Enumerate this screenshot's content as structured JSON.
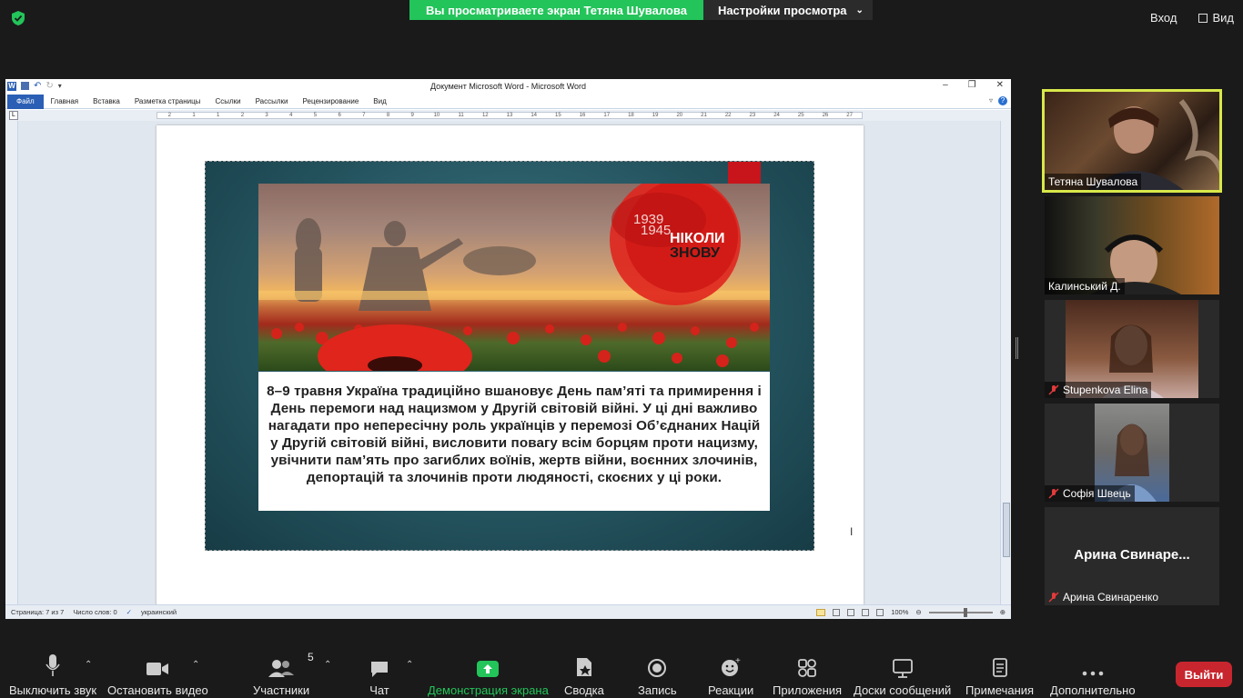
{
  "top": {
    "share_notice": "Вы просматриваете экран Тетяна Шувалова",
    "view_settings": "Настройки просмотра",
    "sign_in": "Вход",
    "view": "Вид"
  },
  "word": {
    "title": "Документ Microsoft Word - Microsoft Word",
    "tabs": [
      "Файл",
      "Главная",
      "Вставка",
      "Разметка страницы",
      "Ссылки",
      "Рассылки",
      "Рецензирование",
      "Вид"
    ],
    "ruler_ticks": [
      "2",
      "1",
      "1",
      "2",
      "3",
      "4",
      "5",
      "6",
      "7",
      "8",
      "9",
      "10",
      "11",
      "12",
      "13",
      "14",
      "15",
      "16",
      "17",
      "18",
      "19",
      "20",
      "21",
      "22",
      "23",
      "24",
      "25",
      "26",
      "27"
    ],
    "status": {
      "page": "Страница: 7 из 7",
      "words": "Число слов: 0",
      "language": "украинский",
      "zoom": "100%"
    },
    "slide": {
      "badge_years_top": "1939",
      "badge_years_bottom": "1945",
      "badge_line1": "НІКОЛИ",
      "badge_line2": "ЗНОВУ",
      "body": "8–9 травня Україна традиційно вшановує День пам’яті та примирення і День перемоги над нацизмом у Другій світовій війні. У ці дні важливо нагадати про неперeсічну роль українців у перемозі Об’єднаних Націй у Другій світовій війні, висловити повагу всім борцям проти нацизму, увічнити пам’ять про загиблих воїнів, жертв війни, воєнних злочинів, депортацій та злочинів проти людяності, скоєних у ці роки."
    }
  },
  "gallery": {
    "participants": [
      {
        "name": "Тетяна Шувалова",
        "muted": false,
        "active": true
      },
      {
        "name": "Калинський Д.",
        "muted": false,
        "active": false
      },
      {
        "name": "Stupenkova Elina",
        "muted": true,
        "active": false
      },
      {
        "name": "Софія Швець",
        "muted": true,
        "active": false
      },
      {
        "name": "Арина Свинаренко",
        "muted": true,
        "active": false,
        "no_video_label": "Арина Свинаре..."
      }
    ]
  },
  "toolbar": {
    "mute": "Выключить звук",
    "stop_video": "Остановить видео",
    "participants": "Участники",
    "participants_count": "5",
    "chat": "Чат",
    "share": "Демонстрация экрана",
    "summary": "Сводка",
    "record": "Запись",
    "reactions": "Реакции",
    "apps": "Приложения",
    "whiteboards": "Доски сообщений",
    "notes": "Примечания",
    "more": "Дополнительно",
    "leave": "Выйти"
  },
  "colors": {
    "zoom_green": "#23c45a",
    "leave_red": "#c8262e",
    "active_speaker": "#d8e84a",
    "word_blue": "#2a5fb5"
  }
}
